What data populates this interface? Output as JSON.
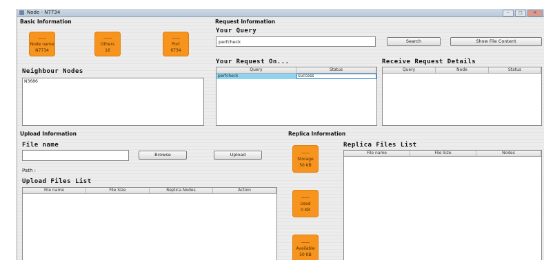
{
  "window": {
    "title": "Node - N7734",
    "buttons": {
      "minimize": "–",
      "maximize": "□",
      "close": "×"
    }
  },
  "basic_info": {
    "header": "Basic Information",
    "tiles": [
      {
        "label": "Node name",
        "value": "N7734"
      },
      {
        "label": "Others",
        "value": "16"
      },
      {
        "label": "Port",
        "value": "6734"
      }
    ]
  },
  "neighbour": {
    "header": "Neighbour Nodes",
    "items": [
      "N3686"
    ]
  },
  "request_info": {
    "header": "Request Information",
    "query_label": "Your Query",
    "query_value": "perfcheck",
    "search_button": "Search",
    "show_button": "Show File Content",
    "your_requests_label": "Your Request On...",
    "your_requests_columns": [
      "Query",
      "Status"
    ],
    "your_requests_rows": [
      {
        "query": "perfcheck",
        "status": "success"
      }
    ],
    "receive_label": "Receive Request Details",
    "receive_columns": [
      "Query",
      "Node",
      "Status"
    ]
  },
  "upload": {
    "header": "Upload Information",
    "file_name_label": "File name",
    "file_name_value": "",
    "browse_button": "Browse",
    "upload_button": "Upload",
    "path_label": "Path :",
    "files_list_label": "Upload Files List",
    "files_columns": [
      "File name",
      "File Size",
      "Replica Nodes",
      "Action"
    ]
  },
  "replica": {
    "header": "Replica Information",
    "tiles": [
      {
        "label": "Storage",
        "value": "50 KB"
      },
      {
        "label": "Used",
        "value": "0 KB"
      },
      {
        "label": "Available",
        "value": "50 KB"
      }
    ],
    "files_list_label": "Replica Files List",
    "files_columns": [
      "File name",
      "File Size",
      "Nodes"
    ]
  }
}
